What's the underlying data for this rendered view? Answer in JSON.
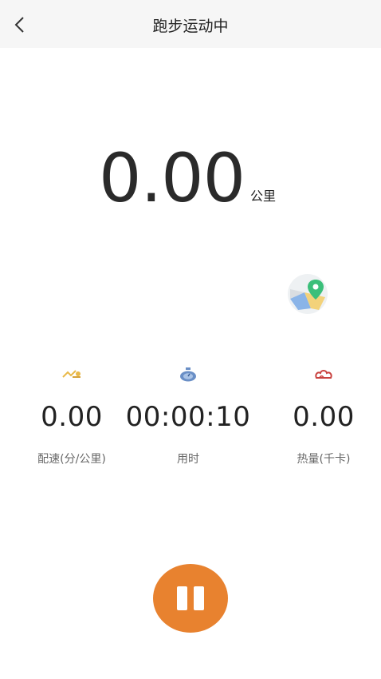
{
  "header": {
    "title": "跑步运动中",
    "back_icon": "chevron-left-icon"
  },
  "distance": {
    "value": "0.00",
    "unit": "公里"
  },
  "map": {
    "icon": "map-pin-icon"
  },
  "stats": [
    {
      "value": "0.00",
      "label": "配速(分/公里)",
      "icon": "pace-icon",
      "color": "#e9b949"
    },
    {
      "value": "00:00:10",
      "label": "用时",
      "icon": "stopwatch-icon",
      "color": "#6a8fc6"
    },
    {
      "value": "0.00",
      "label": "热量(千卡)",
      "icon": "calories-icon",
      "color": "#c9423f"
    }
  ],
  "controls": {
    "pause_icon": "pause-icon",
    "accent": "#e8822f"
  }
}
